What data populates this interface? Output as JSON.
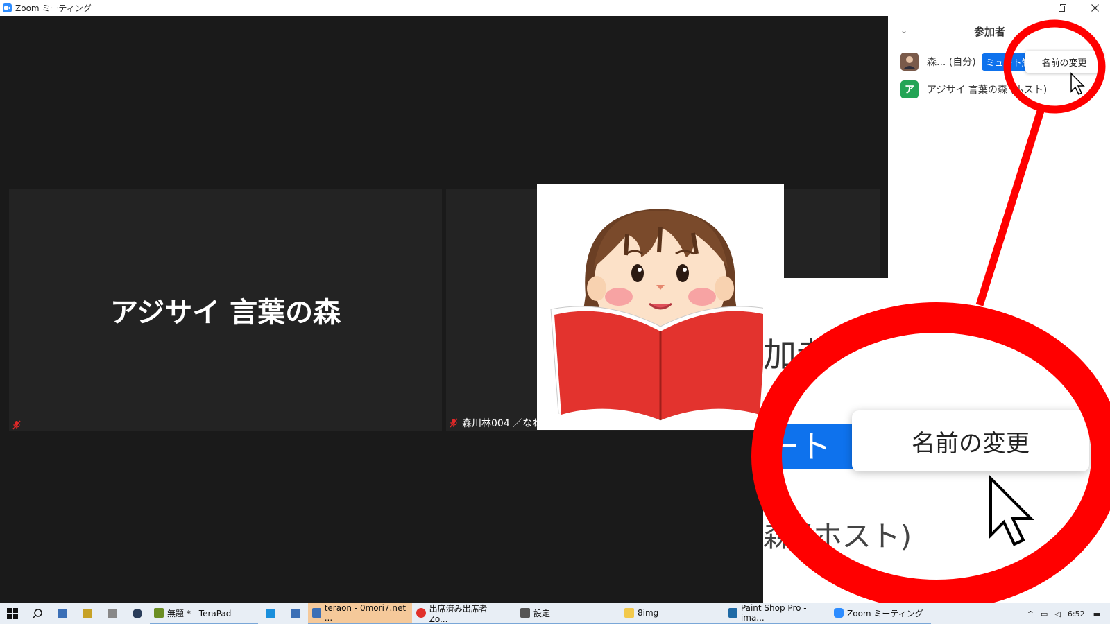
{
  "window": {
    "title": "Zoom ミーティング",
    "minimize_icon": "minimize-icon",
    "restore_icon": "restore-icon",
    "close_icon": "close-icon"
  },
  "video": {
    "tile1": {
      "big_name": "アジサイ 言葉の森"
    },
    "tile2": {
      "footer_name": "森川林004 ／なね"
    }
  },
  "participants": {
    "title": "参加者",
    "rows": [
      {
        "name": "森... (自分)",
        "button": "ミュート解",
        "avatar_color": "#7a5a4a"
      },
      {
        "name": "アジサイ 言葉の森 (ホスト)",
        "avatar_letter": "ア",
        "avatar_color": "#23a455"
      }
    ],
    "popup": {
      "label": "名前の変更"
    }
  },
  "magnified": {
    "title_fragment": "加者",
    "mute_fragment": "ート解",
    "rename_label": "名前の変更",
    "host_fragment": "森 (ホスト)"
  },
  "annotation_color": "#ff0000",
  "taskbar": {
    "items": [
      {
        "label": "無題 * - TeraPad",
        "color": "#6b8e23",
        "active": false
      },
      {
        "label": "teraon - 0mori7.net ...",
        "color": "#3b6fb6",
        "active": true
      },
      {
        "label": "出席済み出席者 - Zo...",
        "color": "#e0302a",
        "active": false
      },
      {
        "label": "設定",
        "color": "#555555",
        "active": false
      },
      {
        "label": "8img",
        "color": "#f2c94c",
        "active": false
      },
      {
        "label": "Paint Shop Pro - ima...",
        "color": "#1f6aa5",
        "active": false
      },
      {
        "label": "Zoom ミーティング",
        "color": "#2d8cff",
        "active": false
      }
    ],
    "clock": "6:52"
  }
}
